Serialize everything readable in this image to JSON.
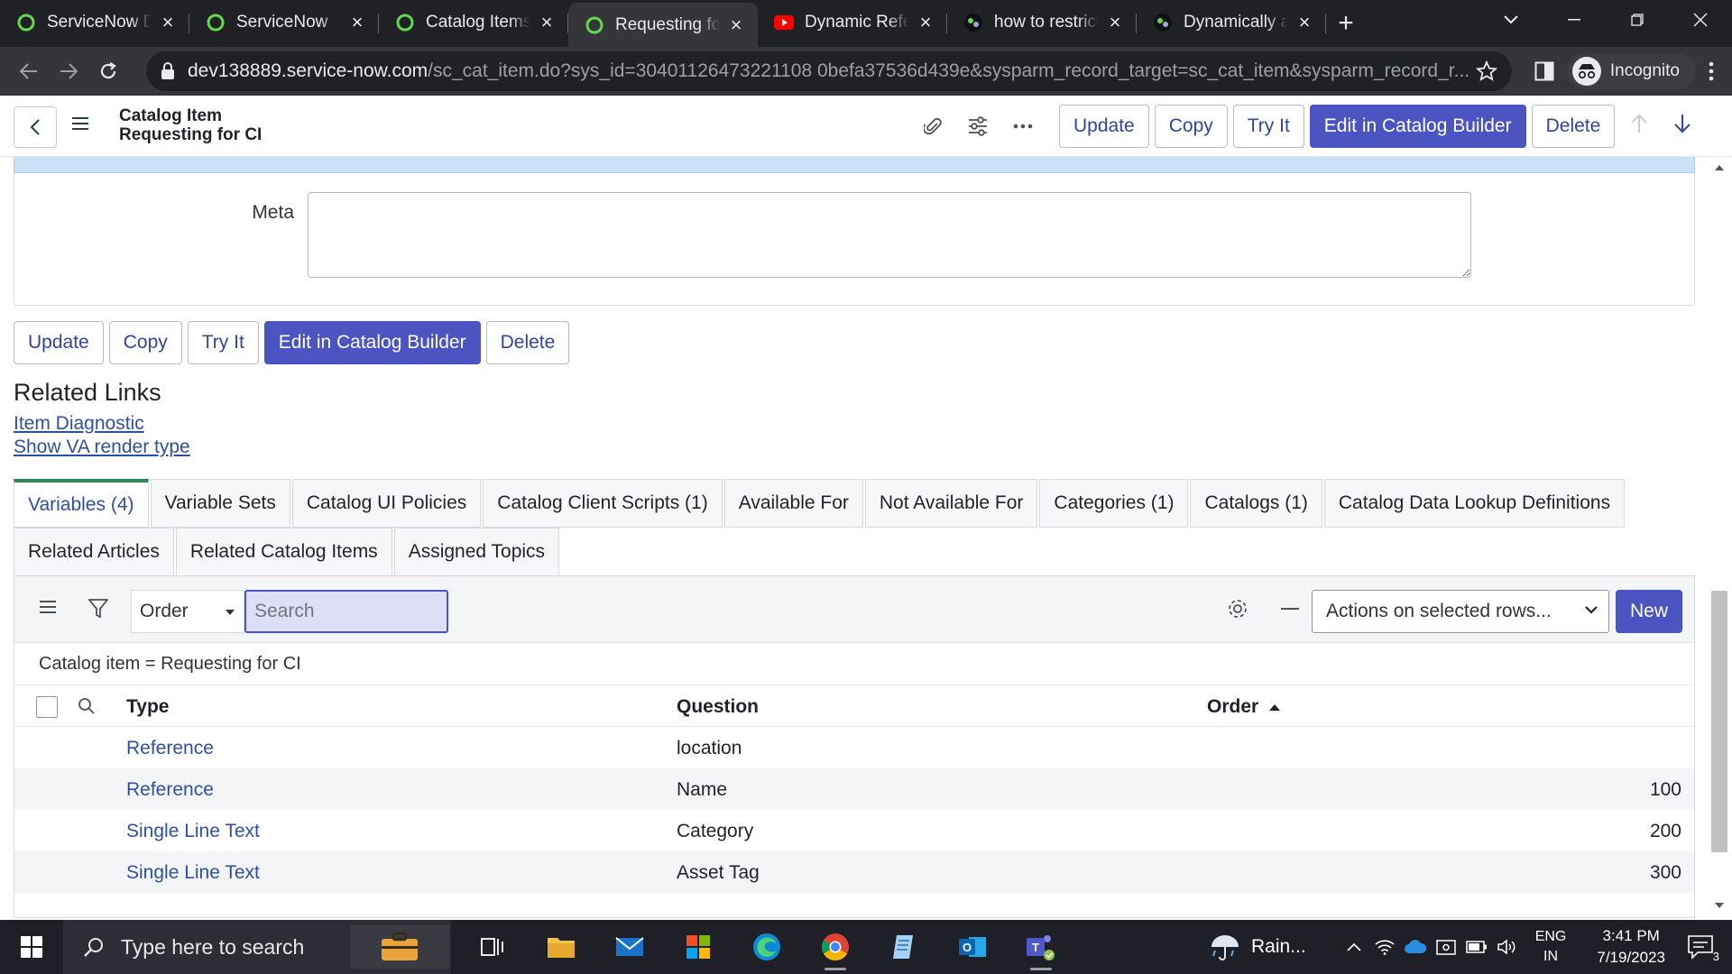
{
  "browser": {
    "tabs": [
      {
        "title": "ServiceNow Developer",
        "icon": "servicenow-icon",
        "active": false
      },
      {
        "title": "ServiceNow",
        "icon": "servicenow-icon",
        "active": false
      },
      {
        "title": "Catalog Items | ServiceNow",
        "icon": "servicenow-icon",
        "active": false
      },
      {
        "title": "Requesting for CI",
        "icon": "servicenow-icon",
        "active": true
      },
      {
        "title": "Dynamic Reference",
        "icon": "youtube-icon",
        "active": false
      },
      {
        "title": "how to restrict",
        "icon": "community-icon",
        "active": false
      },
      {
        "title": "Dynamically add",
        "icon": "community-icon",
        "active": false
      }
    ],
    "url_host": "dev138889.service-now.com",
    "url_path": "/sc_cat_item.do?sys_id=30401126473221108 0befa37536d439e&sysparm_record_target=sc_cat_item&sysparm_record_r...",
    "profile_label": "Incognito"
  },
  "header": {
    "line1": "Catalog Item",
    "line2": "Requesting for CI",
    "buttons": {
      "update": "Update",
      "copy": "Copy",
      "try_it": "Try It",
      "edit_catalog_builder": "Edit in Catalog Builder",
      "delete": "Delete"
    }
  },
  "form": {
    "meta_label": "Meta",
    "meta_value": ""
  },
  "related_links": {
    "title": "Related Links",
    "links": [
      "Item Diagnostic",
      "Show VA render type"
    ]
  },
  "related_tabs_row1": [
    "Variables (4)",
    "Variable Sets",
    "Catalog UI Policies",
    "Catalog Client Scripts (1)",
    "Available For",
    "Not Available For",
    "Categories (1)",
    "Catalogs (1)",
    "Catalog Data Lookup Definitions"
  ],
  "related_tabs_row2": [
    "Related Articles",
    "Related Catalog Items",
    "Assigned Topics"
  ],
  "list": {
    "order_select": "Order",
    "search_placeholder": "Search",
    "actions_select": "Actions on selected rows...",
    "new_label": "New",
    "breadcrumb": "Catalog item = Requesting for CI",
    "columns": {
      "type": "Type",
      "question": "Question",
      "order": "Order"
    },
    "rows": [
      {
        "type": "Reference",
        "question": "location",
        "order": ""
      },
      {
        "type": "Reference",
        "question": "Name",
        "order": "100"
      },
      {
        "type": "Single Line Text",
        "question": "Category",
        "order": "200"
      },
      {
        "type": "Single Line Text",
        "question": "Asset Tag",
        "order": "300"
      }
    ]
  },
  "taskbar": {
    "search_placeholder": "Type here to search",
    "weather": "Rain...",
    "lang_line1": "ENG",
    "lang_line2": "IN",
    "time": "3:41 PM",
    "date": "7/19/2023",
    "notifications": "3"
  },
  "colors": {
    "primary": "#4a55c2",
    "link": "#2f4fa3",
    "active_tab_accent": "#2e8b57",
    "info_strip": "#c9e2f6"
  }
}
